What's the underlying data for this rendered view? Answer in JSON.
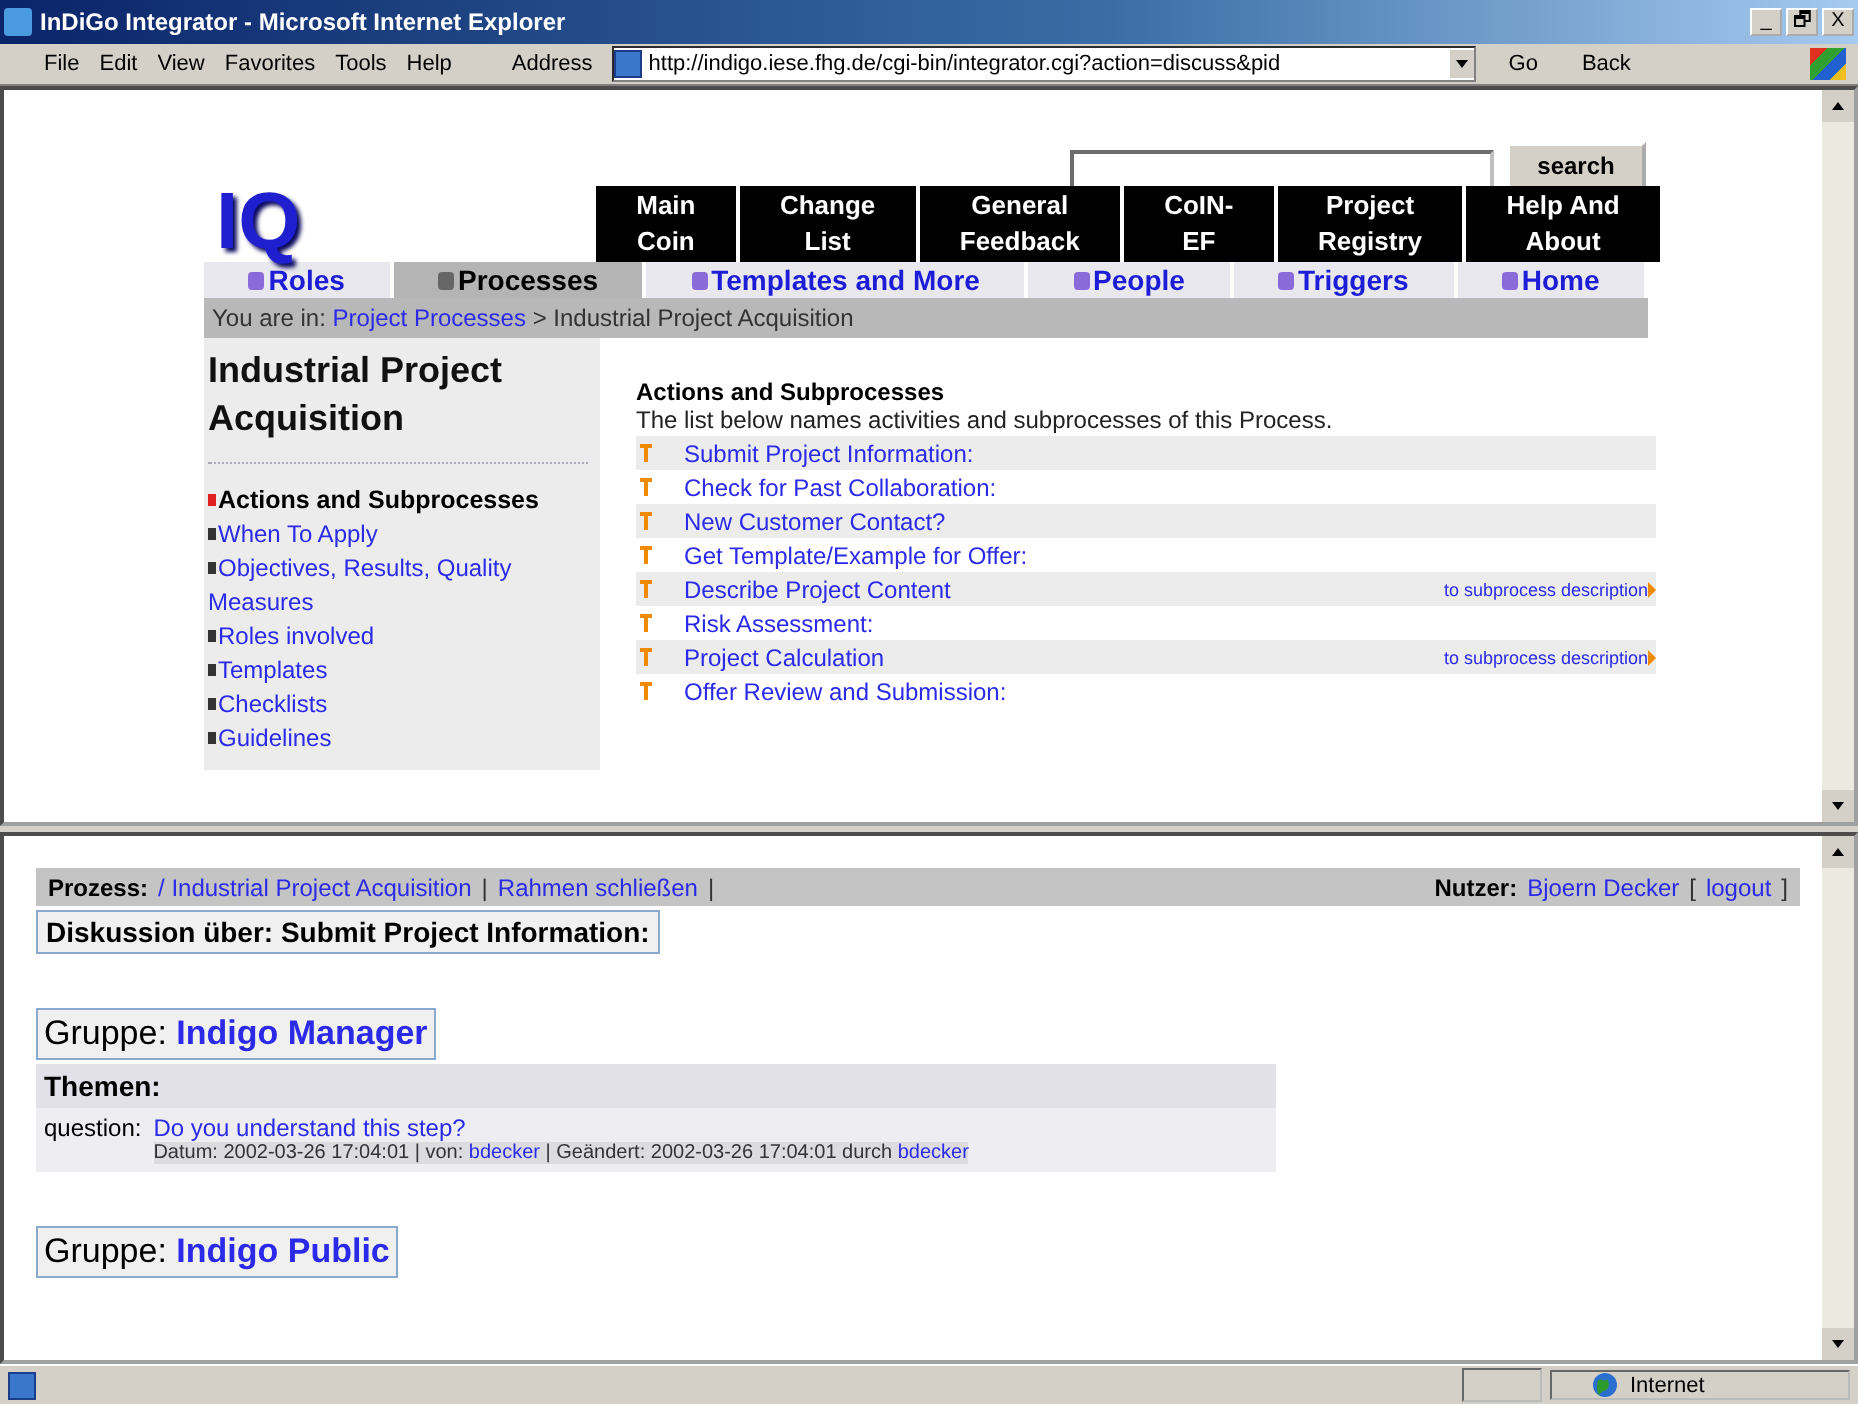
{
  "window": {
    "title": "InDiGo Integrator - Microsoft Internet Explorer",
    "controls": [
      "_",
      "🗗",
      "X"
    ]
  },
  "menu": [
    "File",
    "Edit",
    "View",
    "Favorites",
    "Tools",
    "Help"
  ],
  "address": {
    "label": "Address",
    "url": "http://indigo.iese.fhg.de/cgi-bin/integrator.cgi?action=discuss&pid",
    "go": "Go",
    "back": "Back"
  },
  "top": {
    "search": {
      "button": "search"
    },
    "logo": "IQ",
    "nav": [
      {
        "lines": [
          "Main",
          "Coin"
        ]
      },
      {
        "lines": [
          "Change",
          "List"
        ]
      },
      {
        "lines": [
          "General",
          "Feedback"
        ]
      },
      {
        "lines": [
          "CoIN-",
          "EF"
        ]
      },
      {
        "lines": [
          "Project",
          "Registry"
        ]
      },
      {
        "lines": [
          "Help And",
          "About"
        ]
      }
    ],
    "tabs": [
      {
        "label": "Roles",
        "selected": false
      },
      {
        "label": "Processes",
        "selected": true
      },
      {
        "label": "Templates and More",
        "selected": false
      },
      {
        "label": "People",
        "selected": false
      },
      {
        "label": "Triggers",
        "selected": false
      },
      {
        "label": "Home",
        "selected": false
      }
    ],
    "breadcrumb": {
      "prefix": "You are in:",
      "link": "Project Processes",
      "rest": "> Industrial Project Acquisition"
    },
    "sidebar": {
      "title": "Industrial Project Acquisition",
      "items": [
        {
          "label": "Actions and Subprocesses",
          "selected": true
        },
        {
          "label": "When To Apply",
          "selected": false
        },
        {
          "label": "Objectives, Results, Quality Measures",
          "selected": false
        },
        {
          "label": "Roles involved",
          "selected": false
        },
        {
          "label": "Templates",
          "selected": false
        },
        {
          "label": "Checklists",
          "selected": false
        },
        {
          "label": "Guidelines",
          "selected": false
        }
      ]
    },
    "content": {
      "heading": "Actions and Subprocesses",
      "description": "The list below names activities and subprocesses of this Process.",
      "activities": [
        {
          "label": "Submit Project Information:"
        },
        {
          "label": "Check for Past Collaboration:"
        },
        {
          "label": "New Customer Contact?"
        },
        {
          "label": "Get Template/Example for Offer:"
        },
        {
          "label": "Describe Project Content",
          "link": "to subprocess description"
        },
        {
          "label": "Risk Assessment:"
        },
        {
          "label": "Project Calculation",
          "link": "to subprocess description"
        },
        {
          "label": "Offer Review and Submission:"
        }
      ]
    }
  },
  "bottom": {
    "bar": {
      "process_label": "Prozess:",
      "process_link": "/ Industrial Project Acquisition",
      "separator": "|",
      "close_link": "Rahmen schließen",
      "open_bracket": "[",
      "close_bracket": "]",
      "user_label": "Nutzer:",
      "user": "Bjoern Decker",
      "logout": "logout"
    },
    "discussion_title": "Diskussion über: Submit Project Information:",
    "groups": [
      {
        "label": "Gruppe:",
        "name": "Indigo Manager",
        "topics_label": "Themen:",
        "topics": [
          {
            "type": "question:",
            "title": "Do you understand this step?",
            "date_label": "Datum: 2002-03-26 17:04:01 | von:",
            "author": "bdecker",
            "changed_label": "| Geändert: 2002-03-26 17:04:01 durch",
            "changer": "bdecker"
          }
        ]
      },
      {
        "label": "Gruppe:",
        "name": "Indigo Public"
      }
    ]
  },
  "status_bar": {
    "zone": "Internet"
  }
}
